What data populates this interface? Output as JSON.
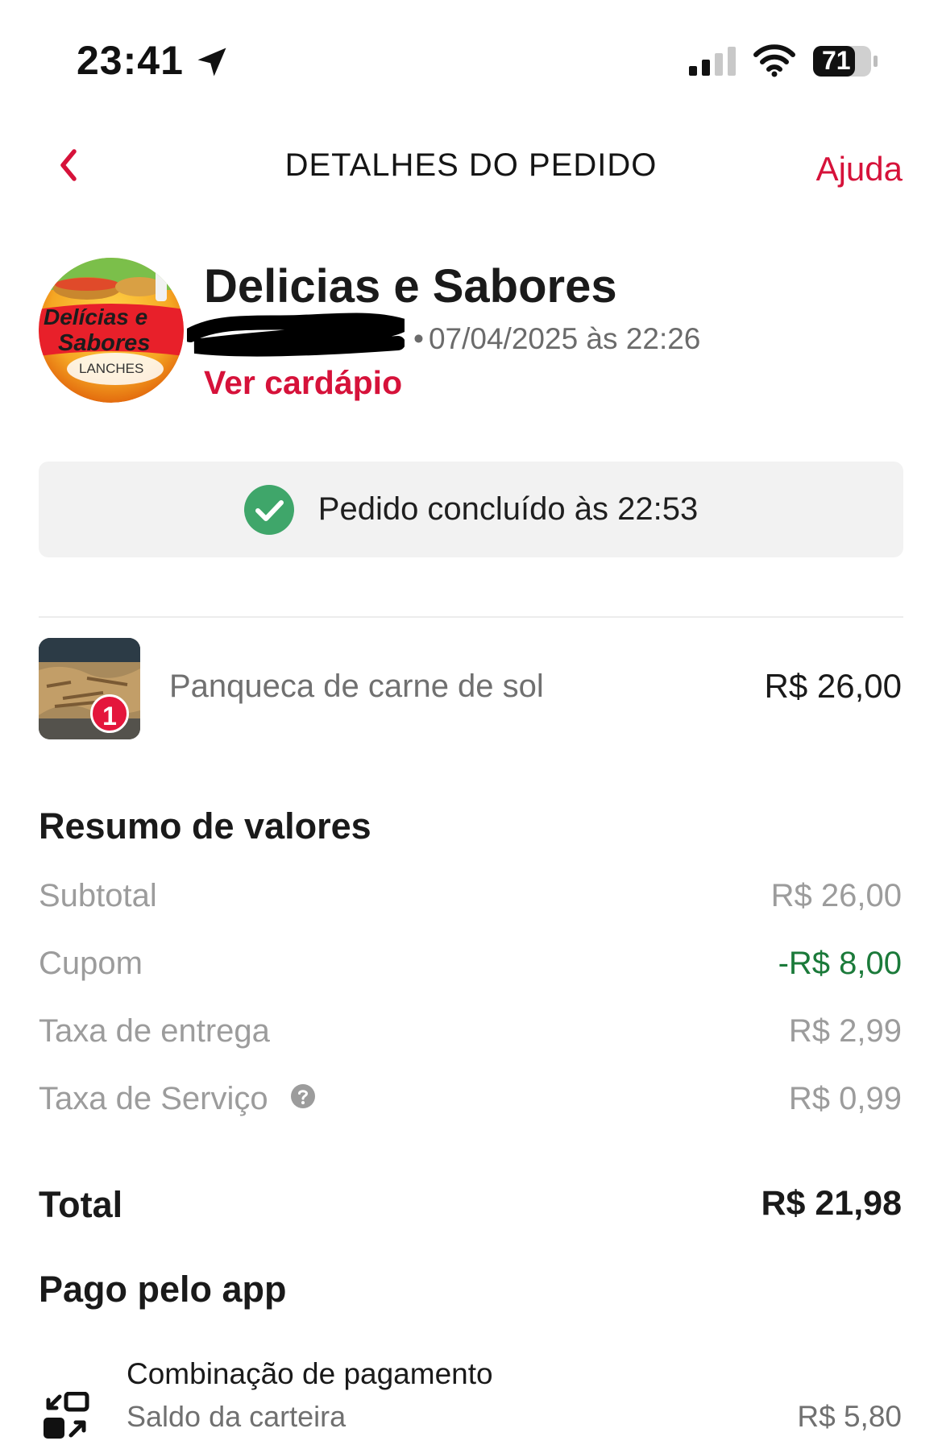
{
  "status_bar": {
    "time": "23:41",
    "battery": "71",
    "icons": [
      "location-arrow-icon",
      "cellular-signal-icon",
      "wifi-icon",
      "battery-icon"
    ]
  },
  "header": {
    "title": "DETALHES DO PEDIDO",
    "help_label": "Ajuda",
    "back_icon": "chevron-left-icon"
  },
  "store": {
    "name": "Delicias e Sabores",
    "logo_text_line1": "Delícias e",
    "logo_text_line2": "Sabores",
    "logo_text_line3": "LANCHES",
    "date_prefix": "•",
    "order_datetime": "07/04/2025 às 22:26",
    "menu_link": "Ver cardápio"
  },
  "status": {
    "text": "Pedido concluído às 22:53",
    "icon": "check-circle-icon",
    "color": "#3fa66a"
  },
  "items": [
    {
      "name": "Panqueca de carne de sol",
      "quantity": "1",
      "price": "R$ 26,00"
    }
  ],
  "summary": {
    "title": "Resumo de valores",
    "rows": [
      {
        "label": "Subtotal",
        "value": "R$ 26,00"
      },
      {
        "label": "Cupom",
        "value": "-R$ 8,00"
      },
      {
        "label": "Taxa de entrega",
        "value": "R$ 2,99"
      },
      {
        "label": "Taxa de Serviço",
        "value": "R$ 0,99"
      }
    ],
    "total_label": "Total",
    "total_value": "R$ 21,98"
  },
  "payment": {
    "title": "Pago pelo app",
    "method_title": "Combinação de pagamento",
    "method_sub": "Saldo da carteira",
    "method_value": "R$ 5,80"
  },
  "colors": {
    "accent": "#d6123a",
    "discount": "#1b7a3a",
    "muted": "#9c9c9c"
  }
}
